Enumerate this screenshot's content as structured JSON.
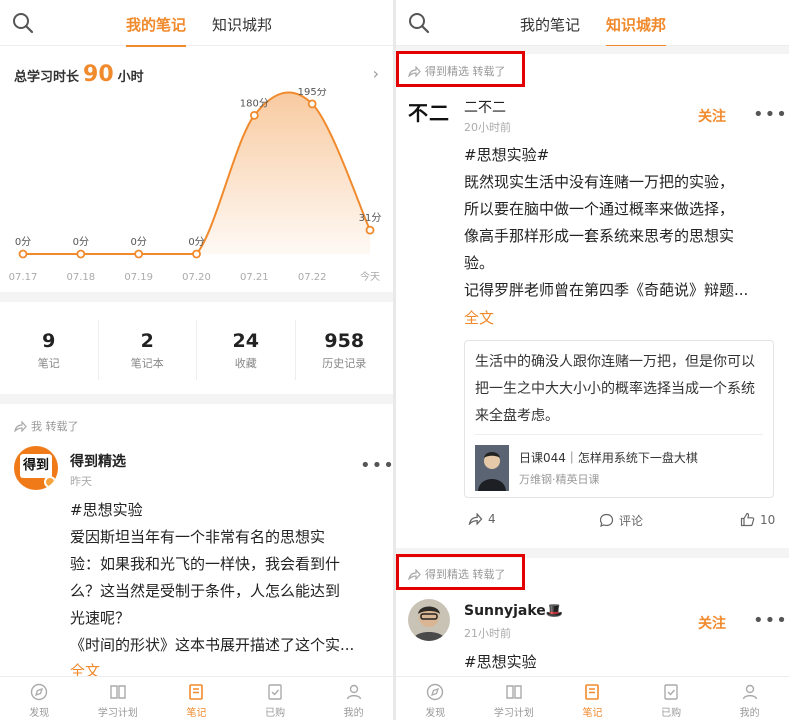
{
  "left": {
    "tabs": [
      {
        "label": "我的笔记"
      },
      {
        "label": "知识城邦"
      }
    ],
    "total": {
      "prefix": "总学习时长",
      "value": "90",
      "unit": "小时"
    },
    "chart_data": {
      "type": "area",
      "x": [
        "07.17",
        "07.18",
        "07.19",
        "07.20",
        "07.21",
        "07.22",
        "今天"
      ],
      "values": [
        0,
        0,
        0,
        0,
        180,
        195,
        31
      ],
      "value_labels": [
        "0分",
        "0分",
        "0分",
        "0分",
        "180分",
        "195分",
        "31分"
      ],
      "accent": "#f08a2d"
    },
    "stats": [
      {
        "num": "9",
        "label": "笔记"
      },
      {
        "num": "2",
        "label": "笔记本"
      },
      {
        "num": "24",
        "label": "收藏"
      },
      {
        "num": "958",
        "label": "历史记录"
      }
    ],
    "post": {
      "repost_label": "我 转载了",
      "avatar_text": "得到",
      "author": "得到精选",
      "time": "昨天",
      "lines": [
        "#思想实验",
        "爱因斯坦当年有一个非常有名的思想实",
        "验：如果我和光飞的一样快，我会看到什",
        "么？这当然是受制于条件，人怎么能达到",
        "光速呢？",
        "《时间的形状》这本书展开描述了这个实..."
      ],
      "more": "全文"
    },
    "bottomnav": [
      {
        "label": "发现",
        "icon": "compass-icon"
      },
      {
        "label": "学习计划",
        "icon": "book-icon"
      },
      {
        "label": "笔记",
        "icon": "note-icon"
      },
      {
        "label": "已购",
        "icon": "purchased-icon"
      },
      {
        "label": "我的",
        "icon": "user-icon"
      }
    ]
  },
  "right": {
    "tabs": [
      {
        "label": "我的笔记"
      },
      {
        "label": "知识城邦"
      }
    ],
    "post1": {
      "repost_label": "得到精选 转载了",
      "avatar_text": "不二",
      "author": "二不二",
      "time": "20小时前",
      "follow": "关注",
      "lines": [
        "#思想实验#",
        "既然现实生活中没有连赌一万把的实验，",
        "所以要在脑中做一个通过概率来做选择，",
        "像高手那样形成一套系统来思考的思想实",
        "验。",
        "记得罗胖老师曾在第四季《奇葩说》辩题..."
      ],
      "more": "全文",
      "quote": {
        "text": "生活中的确没人跟你连赌一万把，但是你可以把一生之中大大小小的概率选择当成一个系统来全盘考虑。",
        "link_title": "日课044｜怎样用系统下一盘大棋",
        "link_sub": "万维钢·精英日课"
      },
      "reposts": "4",
      "comment": "评论",
      "likes": "10"
    },
    "post2": {
      "repost_label": "得到精选 转载了",
      "author": "Sunnyjake🎩",
      "time": "21小时前",
      "follow": "关注",
      "line": "#思想实验"
    },
    "bottomnav": [
      {
        "label": "发现",
        "icon": "compass-icon"
      },
      {
        "label": "学习计划",
        "icon": "book-icon"
      },
      {
        "label": "笔记",
        "icon": "note-icon"
      },
      {
        "label": "已购",
        "icon": "purchased-icon"
      },
      {
        "label": "我的",
        "icon": "user-icon"
      }
    ],
    "colors": {
      "accent": "#f08a2d",
      "highlight": "#e30000"
    }
  }
}
